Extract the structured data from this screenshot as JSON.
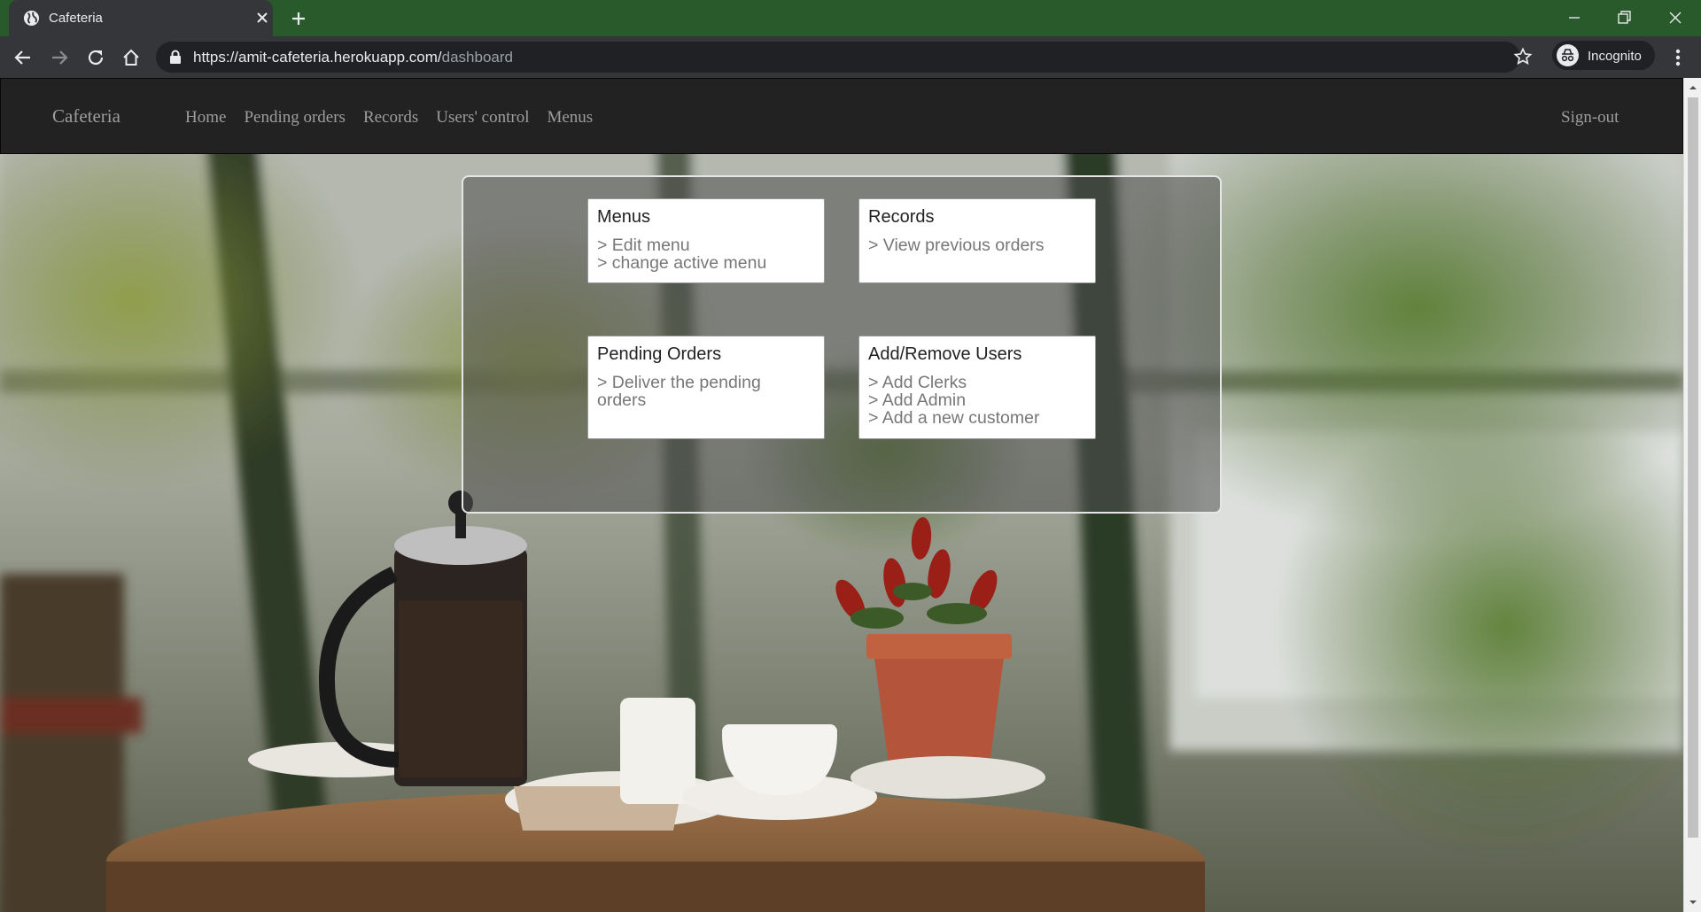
{
  "browser": {
    "tab_title": "Cafeteria",
    "url_host": "https://amit-cafeteria.herokuapp.com/",
    "url_path": "dashboard",
    "incognito_label": "Incognito"
  },
  "navbar": {
    "brand": "Cafeteria",
    "links": [
      "Home",
      "Pending orders",
      "Records",
      "Users' control",
      "Menus"
    ],
    "signout": "Sign-out"
  },
  "cards": [
    {
      "title": "Menus",
      "lines": [
        "> Edit menu",
        "> change active menu"
      ]
    },
    {
      "title": "Records",
      "lines": [
        "> View previous orders"
      ]
    },
    {
      "title": "Pending Orders",
      "lines": [
        "> Deliver the pending",
        "orders"
      ]
    },
    {
      "title": "Add/Remove Users",
      "lines": [
        "> Add Clerks",
        "> Add Admin",
        "> Add a new customer"
      ]
    }
  ],
  "colors": {
    "tabstrip": "#285a2b",
    "chrome": "#35363a",
    "navbar": "#222222",
    "nav_text": "#9d9d9d"
  }
}
